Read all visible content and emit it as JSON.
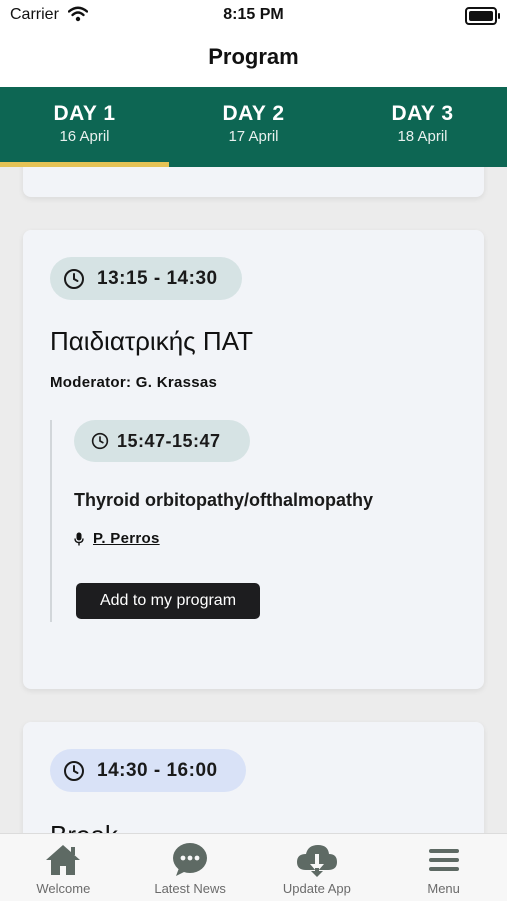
{
  "status_bar": {
    "carrier": "Carrier",
    "time": "8:15 PM"
  },
  "nav": {
    "title": "Program"
  },
  "tabs": [
    {
      "label": "DAY 1",
      "date": "16 April",
      "active": true
    },
    {
      "label": "DAY 2",
      "date": "17 April",
      "active": false
    },
    {
      "label": "DAY 3",
      "date": "18 April",
      "active": false
    }
  ],
  "session": {
    "time": "13:15 - 14:30",
    "title": "Παιδιατρικής ΠΑΤ",
    "moderator": "Moderator: G. Krassas",
    "talk": {
      "time": "15:47-15:47",
      "title": "Thyroid orbitopathy/ofthalmopathy",
      "speaker": "P. Perros",
      "button": "Add to my program"
    }
  },
  "next_session": {
    "time": "14:30 - 16:00",
    "title": "Break"
  },
  "bottom_nav": [
    {
      "label": "Welcome",
      "icon": "home-icon"
    },
    {
      "label": "Latest News",
      "icon": "chat-bubble-icon"
    },
    {
      "label": "Update App",
      "icon": "cloud-download-icon"
    },
    {
      "label": "Menu",
      "icon": "hamburger-menu-icon"
    }
  ],
  "colors": {
    "header_green": "#0d6653",
    "tab_indicator": "#e4c255",
    "pill_teal": "#d6e3e4",
    "pill_blue": "#d9e2f7",
    "button_dark": "#1d1d1f"
  }
}
